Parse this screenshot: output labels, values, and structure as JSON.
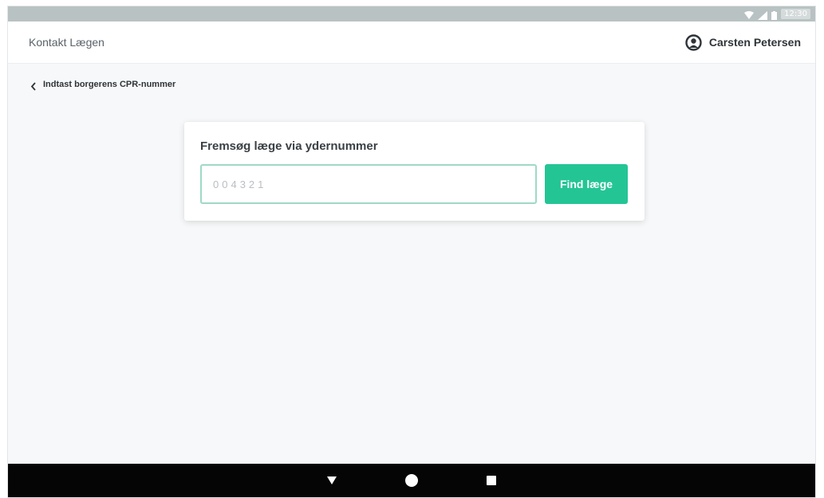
{
  "status_bar": {
    "time": "12:30",
    "icons": [
      "wifi-icon",
      "signal-icon",
      "battery-icon"
    ]
  },
  "header": {
    "title": "Kontakt Lægen",
    "user_name": "Carsten Petersen",
    "user_icon": "user-avatar-icon"
  },
  "back_link": {
    "label": "Indtast borgerens CPR-nummer",
    "icon": "chevron-left-icon"
  },
  "search_card": {
    "title": "Fremsøg læge via ydernummer",
    "input_placeholder": "004321",
    "input_value": "",
    "button_label": "Find læge"
  },
  "nav_bar": {
    "buttons": [
      "back-triangle-icon",
      "home-circle-icon",
      "recents-square-icon"
    ]
  },
  "colors": {
    "accent": "#24c595",
    "input_border": "#9fd9c5",
    "background": "#f6f8f9",
    "status_bar": "#b9c2c2",
    "nav_bar": "#050505"
  }
}
